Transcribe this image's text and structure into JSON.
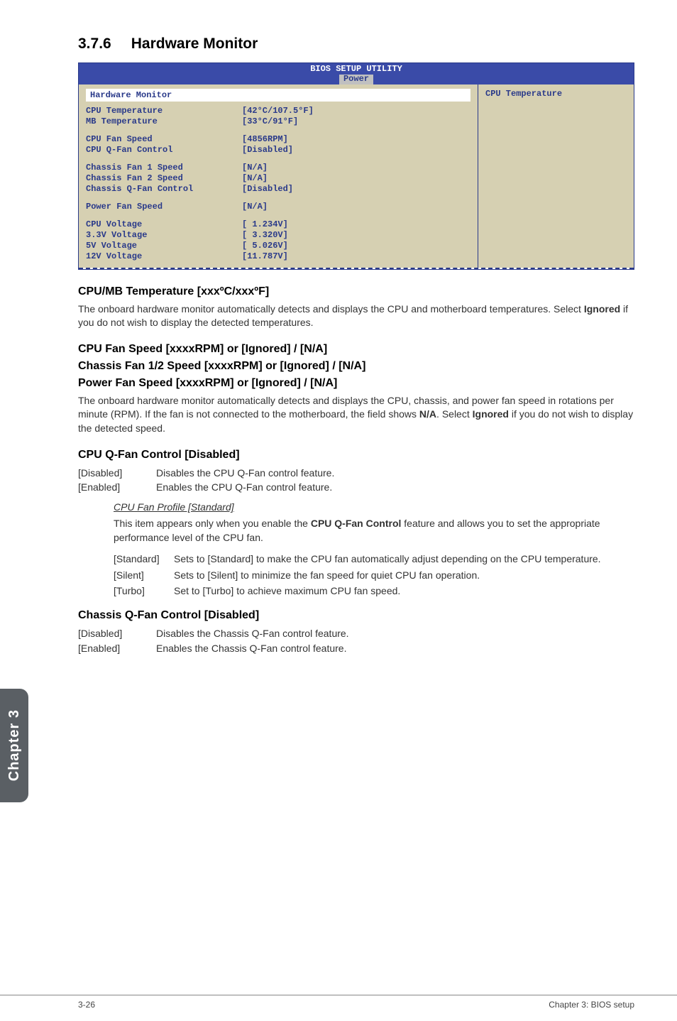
{
  "heading": {
    "num": "3.7.6",
    "title": "Hardware Monitor"
  },
  "bios": {
    "title": "BIOS SETUP UTILITY",
    "tab": "Power",
    "left_header": "Hardware Monitor",
    "right_text": "CPU Temperature",
    "rows": [
      {
        "label": "CPU Temperature",
        "value": "[42°C/107.5°F]"
      },
      {
        "label": "MB Temperature",
        "value": "[33°C/91°F]"
      }
    ],
    "rows2": [
      {
        "label": "CPU Fan Speed",
        "value": "[4856RPM]"
      },
      {
        "label": "CPU Q-Fan Control",
        "value": "[Disabled]"
      }
    ],
    "rows3": [
      {
        "label": "Chassis Fan 1 Speed",
        "value": "[N/A]"
      },
      {
        "label": "Chassis Fan 2 Speed",
        "value": "[N/A]"
      },
      {
        "label": "Chassis Q-Fan Control",
        "value": "[Disabled]"
      }
    ],
    "rows4": [
      {
        "label": "Power Fan Speed",
        "value": "[N/A]"
      }
    ],
    "rows5": [
      {
        "label": "CPU Voltage",
        "value": "[ 1.234V]"
      },
      {
        "label": "3.3V Voltage",
        "value": "[ 3.320V]"
      },
      {
        "label": "5V Voltage",
        "value": "[ 5.026V]"
      },
      {
        "label": "12V Voltage",
        "value": "[11.787V]"
      }
    ]
  },
  "sec1": {
    "h": "CPU/MB Temperature [xxxºC/xxxºF]",
    "p_a": "The onboard hardware monitor automatically detects and displays the CPU and motherboard temperatures. Select ",
    "p_b": "Ignored",
    "p_c": " if you do not wish to display the detected temperatures."
  },
  "sec2": {
    "h1": "CPU Fan Speed [xxxxRPM] or [Ignored] / [N/A]",
    "h2": "Chassis Fan 1/2 Speed [xxxxRPM] or [Ignored] / [N/A]",
    "h3": "Power Fan Speed [xxxxRPM] or [Ignored] / [N/A]",
    "p_a": "The onboard hardware monitor automatically detects and displays the CPU, chassis, and power fan speed in rotations per minute (RPM). If the fan is not connected to the motherboard, the field shows ",
    "p_b": "N/A",
    "p_c": ". Select ",
    "p_d": "Ignored",
    "p_e": " if you do not wish to display the detected speed."
  },
  "sec3": {
    "h": "CPU Q-Fan Control [Disabled]",
    "opts": [
      {
        "k": "[Disabled]",
        "v": "Disables the CPU Q-Fan control feature."
      },
      {
        "k": "[Enabled]",
        "v": "Enables the CPU Q-Fan control feature."
      }
    ],
    "sub_title": "CPU Fan Profile [Standard]",
    "sub_p_a": "This item appears only when you enable the ",
    "sub_p_b": "CPU Q-Fan Control",
    "sub_p_c": " feature and allows you to set the appropriate performance level of the CPU fan.",
    "sub_opts": [
      {
        "k": "[Standard]",
        "v": "Sets to [Standard] to make the CPU fan automatically adjust depending on the CPU temperature."
      },
      {
        "k": "[Silent]",
        "v": "Sets to [Silent] to minimize the fan speed for quiet CPU fan operation."
      },
      {
        "k": "[Turbo]",
        "v": "Set to [Turbo] to achieve maximum CPU fan speed."
      }
    ]
  },
  "sec4": {
    "h": "Chassis Q-Fan Control [Disabled]",
    "opts": [
      {
        "k": "[Disabled]",
        "v": "Disables the Chassis Q-Fan control feature."
      },
      {
        "k": "[Enabled]",
        "v": "Enables the Chassis Q-Fan control feature."
      }
    ]
  },
  "sidebar": "Chapter 3",
  "footer": {
    "left": "3-26",
    "right": "Chapter 3: BIOS setup"
  }
}
